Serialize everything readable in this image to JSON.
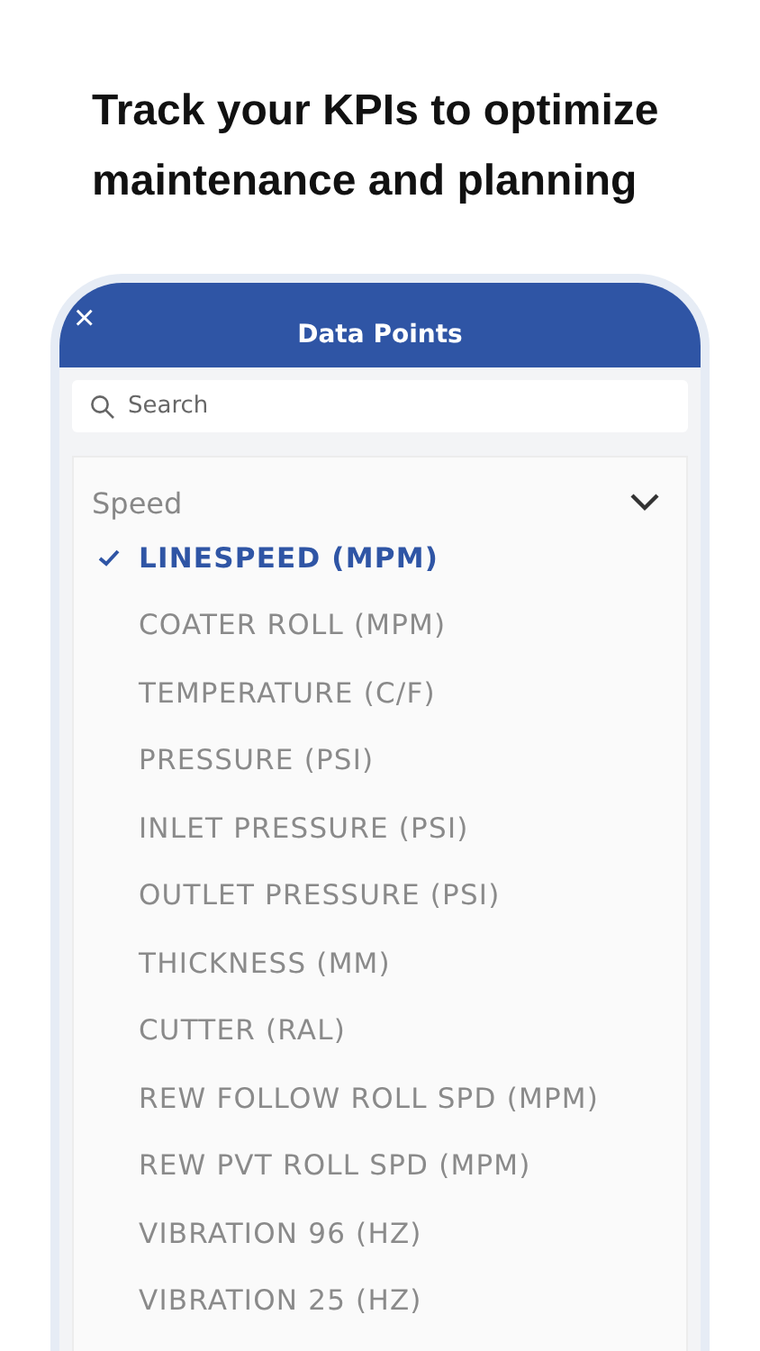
{
  "headline": "Track your KPIs to optimize maintenance and planning",
  "dialog": {
    "title": "Data Points",
    "close": "×"
  },
  "search": {
    "placeholder": "Search"
  },
  "group": {
    "label": "Speed",
    "expanded": true,
    "items": [
      {
        "label": "LINESPEED (MPM)",
        "selected": true
      },
      {
        "label": "COATER ROLL (MPM)",
        "selected": false
      },
      {
        "label": "TEMPERATURE (C/F)",
        "selected": false
      },
      {
        "label": "PRESSURE (PSI)",
        "selected": false
      },
      {
        "label": "INLET PRESSURE (PSI)",
        "selected": false
      },
      {
        "label": "OUTLET PRESSURE (PSI)",
        "selected": false
      },
      {
        "label": "THICKNESS (MM)",
        "selected": false
      },
      {
        "label": "CUTTER (RAL)",
        "selected": false
      },
      {
        "label": "REW FOLLOW ROLL SPD (MPM)",
        "selected": false
      },
      {
        "label": "REW PVT ROLL SPD (MPM)",
        "selected": false
      },
      {
        "label": "VIBRATION 96 (HZ)",
        "selected": false
      },
      {
        "label": "VIBRATION 25 (HZ)",
        "selected": false
      }
    ]
  }
}
